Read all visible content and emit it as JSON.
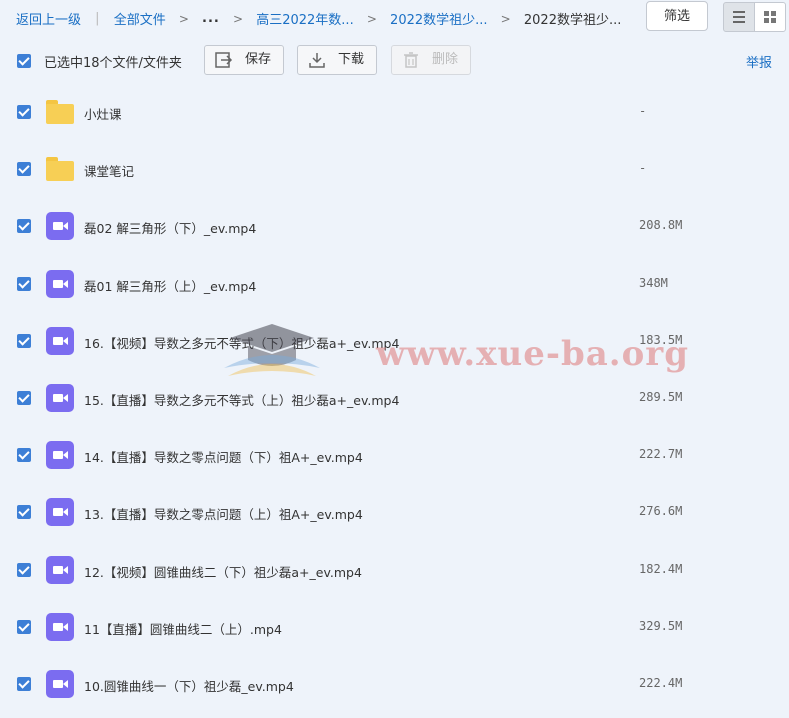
{
  "breadcrumb": {
    "back": "返回上一级",
    "all_files": "全部文件",
    "ellipsis": "...",
    "level1": "高三2022年数...",
    "level2": "2022数学祖少...",
    "current": "2022数学祖少..."
  },
  "header": {
    "filter_label": "筛选",
    "view_list_icon": "list-view-icon",
    "view_grid_icon": "grid-view-icon"
  },
  "toolbar": {
    "selection_text": "已选中18个文件/文件夹",
    "save_label": "保存",
    "download_label": "下载",
    "delete_label": "删除",
    "report_label": "举报"
  },
  "files": [
    {
      "name": "小灶课",
      "size": "-",
      "type": "folder"
    },
    {
      "name": "课堂笔记",
      "size": "-",
      "type": "folder"
    },
    {
      "name": "磊02 解三角形（下）_ev.mp4",
      "size": "208.8M",
      "type": "video"
    },
    {
      "name": "磊01 解三角形（上）_ev.mp4",
      "size": "348M",
      "type": "video"
    },
    {
      "name": "16.【视频】导数之多元不等式（下）祖少磊a+_ev.mp4",
      "size": "183.5M",
      "type": "video"
    },
    {
      "name": "15.【直播】导数之多元不等式（上）祖少磊a+_ev.mp4",
      "size": "289.5M",
      "type": "video"
    },
    {
      "name": "14.【直播】导数之零点问题（下）祖A+_ev.mp4",
      "size": "222.7M",
      "type": "video"
    },
    {
      "name": "13.【直播】导数之零点问题（上）祖A+_ev.mp4",
      "size": "276.6M",
      "type": "video"
    },
    {
      "name": "12.【视频】圆锥曲线二（下）祖少磊a+_ev.mp4",
      "size": "182.4M",
      "type": "video"
    },
    {
      "name": "11【直播】圆锥曲线二（上）.mp4",
      "size": "329.5M",
      "type": "video"
    },
    {
      "name": "10.圆锥曲线一（下）祖少磊_ev.mp4",
      "size": "222.4M",
      "type": "video"
    }
  ],
  "watermark": {
    "text": "www.xue-ba.org"
  },
  "colors": {
    "accent": "#1a6fc4",
    "checkbox": "#3d7fd6",
    "folder": "#f7cf55",
    "video": "#7b6cf0",
    "background": "#eef3fa"
  }
}
